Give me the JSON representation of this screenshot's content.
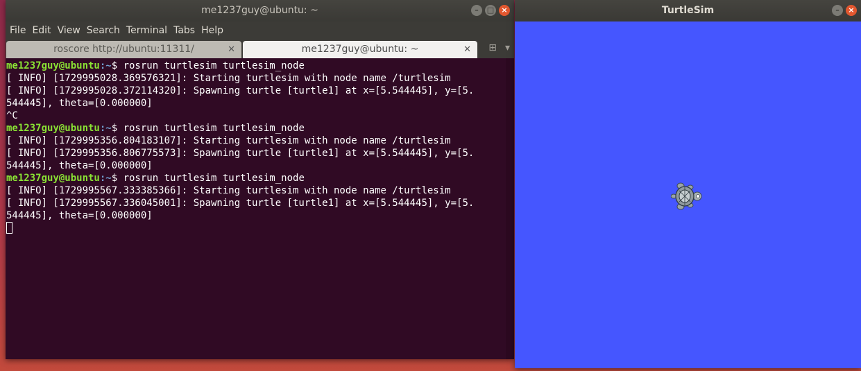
{
  "terminal": {
    "window_title": "me1237guy@ubuntu: ~",
    "menu": [
      "File",
      "Edit",
      "View",
      "Search",
      "Terminal",
      "Tabs",
      "Help"
    ],
    "tabs": [
      {
        "label": "roscore http://ubuntu:11311/",
        "active": false
      },
      {
        "label": "me1237guy@ubuntu: ~",
        "active": true
      }
    ],
    "lines": [
      {
        "type": "prompt",
        "user": "me1237guy@ubuntu",
        "path": ":~",
        "cmd": "$ rosrun turtlesim turtlesim_node"
      },
      {
        "type": "out",
        "text": "[ INFO] [1729995028.369576321]: Starting turtlesim with node name /turtlesim"
      },
      {
        "type": "out",
        "text": "[ INFO] [1729995028.372114320]: Spawning turtle [turtle1] at x=[5.544445], y=[5."
      },
      {
        "type": "out",
        "text": "544445], theta=[0.000000]"
      },
      {
        "type": "out",
        "text": "^C"
      },
      {
        "type": "prompt",
        "user": "me1237guy@ubuntu",
        "path": ":~",
        "cmd": "$ rosrun turtlesim turtlesim_node"
      },
      {
        "type": "out",
        "text": "[ INFO] [1729995356.804183107]: Starting turtlesim with node name /turtlesim"
      },
      {
        "type": "out",
        "text": "[ INFO] [1729995356.806775573]: Spawning turtle [turtle1] at x=[5.544445], y=[5."
      },
      {
        "type": "out",
        "text": "544445], theta=[0.000000]"
      },
      {
        "type": "prompt",
        "user": "me1237guy@ubuntu",
        "path": ":~",
        "cmd": "$ rosrun turtlesim turtlesim_node"
      },
      {
        "type": "out",
        "text": "[ INFO] [1729995567.333385366]: Starting turtlesim with node name /turtlesim"
      },
      {
        "type": "out",
        "text": "[ INFO] [1729995567.336045001]: Spawning turtle [turtle1] at x=[5.544445], y=[5."
      },
      {
        "type": "out",
        "text": "544445], theta=[0.000000]"
      }
    ]
  },
  "turtlesim": {
    "window_title": "TurtleSim",
    "background_color": "#4556ff",
    "turtle_icon": "turtle-icon"
  },
  "controls": {
    "minimize": "–",
    "maximize": "□",
    "close": "×"
  }
}
